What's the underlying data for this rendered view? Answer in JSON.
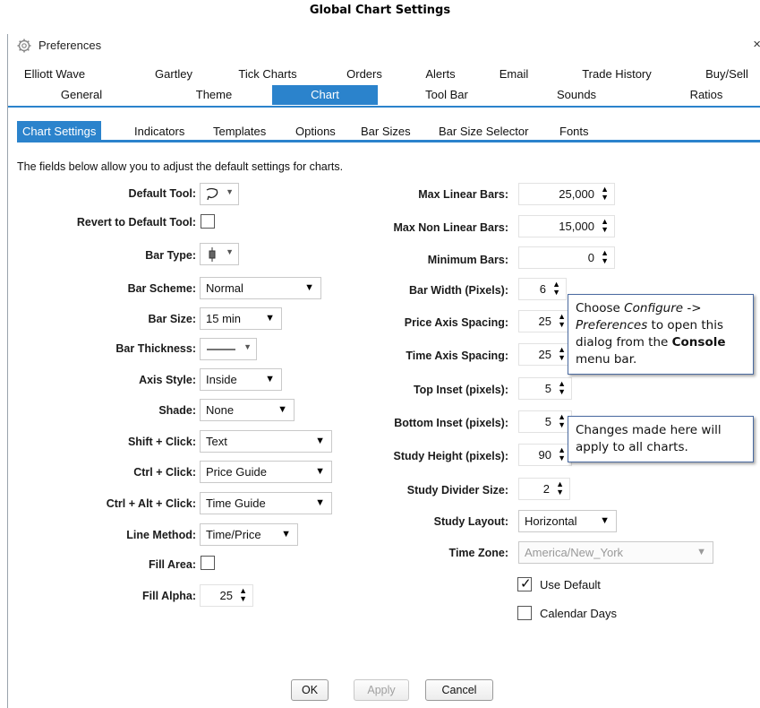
{
  "heading": "Global Chart Settings",
  "window": {
    "title": "Preferences",
    "close": "×"
  },
  "tabs_row1": [
    "Elliott Wave",
    "Gartley",
    "Tick Charts",
    "Orders",
    "Alerts",
    "Email",
    "Trade History",
    "Buy/Sell"
  ],
  "tabs_row2": [
    "General",
    "Theme",
    "Chart",
    "Tool Bar",
    "Sounds",
    "Ratios"
  ],
  "active_tab": "Chart",
  "subtabs": [
    "Chart Settings",
    "Indicators",
    "Templates",
    "Options",
    "Bar Sizes",
    "Bar Size Selector",
    "Fonts"
  ],
  "active_subtab": "Chart Settings",
  "intro": "The fields below allow you to adjust the default settings for charts.",
  "left": {
    "default_tool": {
      "label": "Default Tool:"
    },
    "revert_default_tool": {
      "label": "Revert to Default Tool:",
      "checked": false
    },
    "bar_type": {
      "label": "Bar Type:"
    },
    "bar_scheme": {
      "label": "Bar Scheme:",
      "value": "Normal"
    },
    "bar_size": {
      "label": "Bar Size:",
      "value": "15 min"
    },
    "bar_thickness": {
      "label": "Bar Thickness:"
    },
    "axis_style": {
      "label": "Axis Style:",
      "value": "Inside"
    },
    "shade": {
      "label": "Shade:",
      "value": "None"
    },
    "shift_click": {
      "label": "Shift + Click:",
      "value": "Text"
    },
    "ctrl_click": {
      "label": "Ctrl + Click:",
      "value": "Price Guide"
    },
    "ctrl_alt_click": {
      "label": "Ctrl + Alt + Click:",
      "value": "Time Guide"
    },
    "line_method": {
      "label": "Line Method:",
      "value": "Time/Price"
    },
    "fill_area": {
      "label": "Fill Area:",
      "checked": false
    },
    "fill_alpha": {
      "label": "Fill Alpha:",
      "value": "25"
    }
  },
  "right": {
    "max_linear_bars": {
      "label": "Max Linear Bars:",
      "value": "25,000"
    },
    "max_non_linear_bars": {
      "label": "Max Non Linear Bars:",
      "value": "15,000"
    },
    "minimum_bars": {
      "label": "Minimum Bars:",
      "value": "0"
    },
    "bar_width": {
      "label": "Bar Width (Pixels):",
      "value": "6"
    },
    "price_axis_spacing": {
      "label": "Price Axis Spacing:",
      "value": "25"
    },
    "time_axis_spacing": {
      "label": "Time Axis Spacing:",
      "value": "25"
    },
    "top_inset": {
      "label": "Top Inset (pixels):",
      "value": "5"
    },
    "bottom_inset": {
      "label": "Bottom Inset (pixels):",
      "value": "5"
    },
    "study_height": {
      "label": "Study Height (pixels):",
      "value": "90"
    },
    "study_divider_size": {
      "label": "Study Divider Size:",
      "value": "2"
    },
    "study_layout": {
      "label": "Study Layout:",
      "value": "Horizontal"
    },
    "time_zone": {
      "label": "Time Zone:",
      "value": "America/New_York"
    },
    "use_default": {
      "label": "Use Default",
      "checked": true
    },
    "calendar_days": {
      "label": "Calendar Days",
      "checked": false
    }
  },
  "callouts": {
    "c1": {
      "pre": "Choose ",
      "em": "Configure -> Preferences",
      "mid": " to open this dialog from the ",
      "strong": "Console",
      "post": " menu bar."
    },
    "c2": "Changes made here will apply to all charts."
  },
  "buttons": {
    "ok": "OK",
    "apply": "Apply",
    "cancel": "Cancel"
  },
  "icons": {
    "spinner_up": "▲",
    "spinner_down": "▼",
    "dropdown": "▼"
  },
  "colors": {
    "accent": "#2b83cc"
  }
}
